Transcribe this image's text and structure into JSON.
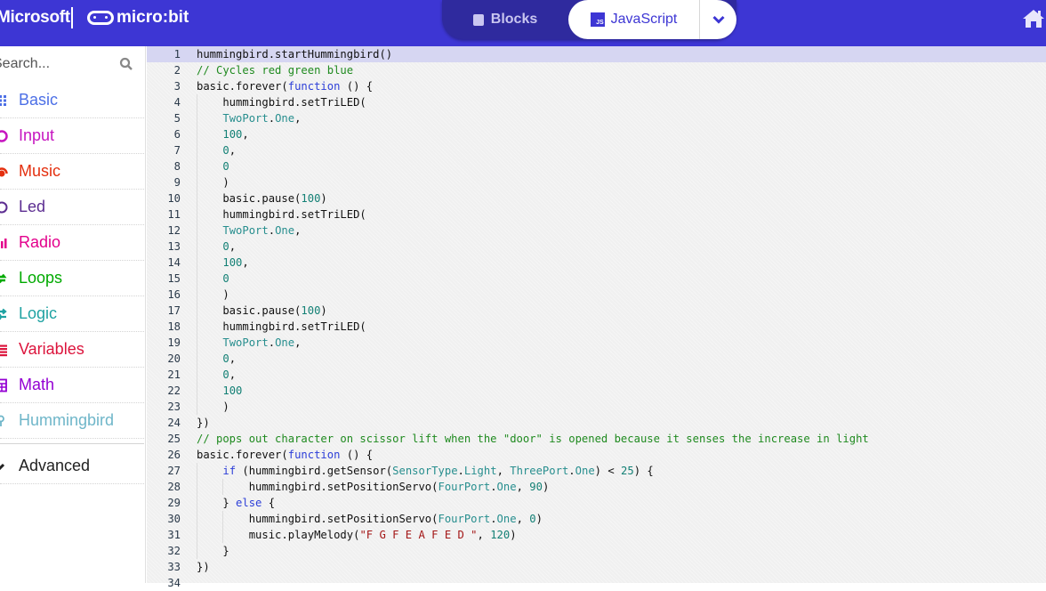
{
  "header": {
    "brand_microsoft": "Microsoft",
    "brand_microbit": "micro:bit",
    "tab_blocks": "Blocks",
    "tab_javascript": "JavaScript",
    "js_badge": "JS",
    "active_tab": "JavaScript",
    "icons": {
      "blocks": "puzzle-icon",
      "more": "chevron-down-icon",
      "home": "home-icon"
    }
  },
  "sidebar": {
    "search_placeholder": "Search...",
    "categories": [
      {
        "label": "Basic",
        "color": "#4c6fe6",
        "icon": "grid-icon"
      },
      {
        "label": "Input",
        "color": "#c616c0",
        "icon": "circle-dot-icon"
      },
      {
        "label": "Music",
        "color": "#e4300f",
        "icon": "headphones-icon"
      },
      {
        "label": "Led",
        "color": "#5c2d91",
        "icon": "toggle-icon"
      },
      {
        "label": "Radio",
        "color": "#e3008c",
        "icon": "signal-bars-icon"
      },
      {
        "label": "Loops",
        "color": "#00aa00",
        "icon": "refresh-icon"
      },
      {
        "label": "Logic",
        "color": "#1fa2a2",
        "icon": "shuffle-icon"
      },
      {
        "label": "Variables",
        "color": "#dc143c",
        "icon": "list-icon"
      },
      {
        "label": "Math",
        "color": "#9400d3",
        "icon": "calculator-icon"
      },
      {
        "label": "Hummingbird",
        "color": "#6fb6c9",
        "icon": "bird-icon"
      }
    ],
    "advanced": {
      "label": "Advanced",
      "color": "#222222",
      "icon": "chevron-icon"
    }
  },
  "editor": {
    "active_line": 1,
    "lines": [
      [
        [
          "hummingbird.startHummingbird()",
          ""
        ]
      ],
      [
        [
          "// Cycles red green blue",
          "c"
        ]
      ],
      [
        [
          "basic.forever(",
          ""
        ],
        [
          "function",
          "k"
        ],
        [
          " () {",
          ""
        ]
      ],
      [
        [
          "    hummingbird.setTriLED(",
          ""
        ]
      ],
      [
        [
          "    ",
          ""
        ],
        [
          "TwoPort",
          "t"
        ],
        [
          ".",
          ""
        ],
        [
          "One",
          "t"
        ],
        [
          ",",
          ""
        ]
      ],
      [
        [
          "    ",
          ""
        ],
        [
          "100",
          "n"
        ],
        [
          ",",
          ""
        ]
      ],
      [
        [
          "    ",
          ""
        ],
        [
          "0",
          "n"
        ],
        [
          ",",
          ""
        ]
      ],
      [
        [
          "    ",
          ""
        ],
        [
          "0",
          "n"
        ]
      ],
      [
        [
          "    )",
          ""
        ]
      ],
      [
        [
          "    basic.pause(",
          ""
        ],
        [
          "100",
          "n"
        ],
        [
          ")",
          ""
        ]
      ],
      [
        [
          "    hummingbird.setTriLED(",
          ""
        ]
      ],
      [
        [
          "    ",
          ""
        ],
        [
          "TwoPort",
          "t"
        ],
        [
          ".",
          ""
        ],
        [
          "One",
          "t"
        ],
        [
          ",",
          ""
        ]
      ],
      [
        [
          "    ",
          ""
        ],
        [
          "0",
          "n"
        ],
        [
          ",",
          ""
        ]
      ],
      [
        [
          "    ",
          ""
        ],
        [
          "100",
          "n"
        ],
        [
          ",",
          ""
        ]
      ],
      [
        [
          "    ",
          ""
        ],
        [
          "0",
          "n"
        ]
      ],
      [
        [
          "    )",
          ""
        ]
      ],
      [
        [
          "    basic.pause(",
          ""
        ],
        [
          "100",
          "n"
        ],
        [
          ")",
          ""
        ]
      ],
      [
        [
          "    hummingbird.setTriLED(",
          ""
        ]
      ],
      [
        [
          "    ",
          ""
        ],
        [
          "TwoPort",
          "t"
        ],
        [
          ".",
          ""
        ],
        [
          "One",
          "t"
        ],
        [
          ",",
          ""
        ]
      ],
      [
        [
          "    ",
          ""
        ],
        [
          "0",
          "n"
        ],
        [
          ",",
          ""
        ]
      ],
      [
        [
          "    ",
          ""
        ],
        [
          "0",
          "n"
        ],
        [
          ",",
          ""
        ]
      ],
      [
        [
          "    ",
          ""
        ],
        [
          "100",
          "n"
        ]
      ],
      [
        [
          "    )",
          ""
        ]
      ],
      [
        [
          "})",
          ""
        ]
      ],
      [
        [
          "// pops out character on scissor lift when the \"door\" is opened because it senses the increase in light",
          "c"
        ]
      ],
      [
        [
          "basic.forever(",
          ""
        ],
        [
          "function",
          "k"
        ],
        [
          " () {",
          ""
        ]
      ],
      [
        [
          "    ",
          ""
        ],
        [
          "if",
          "k"
        ],
        [
          " (hummingbird.getSensor(",
          ""
        ],
        [
          "SensorType",
          "t"
        ],
        [
          ".",
          ""
        ],
        [
          "Light",
          "t"
        ],
        [
          ", ",
          ""
        ],
        [
          "ThreePort",
          "t"
        ],
        [
          ".",
          ""
        ],
        [
          "One",
          "t"
        ],
        [
          ") < ",
          ""
        ],
        [
          "25",
          "n"
        ],
        [
          ") {",
          ""
        ]
      ],
      [
        [
          "        hummingbird.setPositionServo(",
          ""
        ],
        [
          "FourPort",
          "t"
        ],
        [
          ".",
          ""
        ],
        [
          "One",
          "t"
        ],
        [
          ", ",
          ""
        ],
        [
          "90",
          "n"
        ],
        [
          ")",
          ""
        ]
      ],
      [
        [
          "    } ",
          ""
        ],
        [
          "else",
          "k"
        ],
        [
          " {",
          ""
        ]
      ],
      [
        [
          "        hummingbird.setPositionServo(",
          ""
        ],
        [
          "FourPort",
          "t"
        ],
        [
          ".",
          ""
        ],
        [
          "One",
          "t"
        ],
        [
          ", ",
          ""
        ],
        [
          "0",
          "n"
        ],
        [
          ")",
          ""
        ]
      ],
      [
        [
          "        music.playMelody(",
          ""
        ],
        [
          "\"F G F E A F E D \"",
          "s"
        ],
        [
          ", ",
          ""
        ],
        [
          "120",
          "n"
        ],
        [
          ")",
          ""
        ]
      ],
      [
        [
          "    }",
          ""
        ]
      ],
      [
        [
          "})",
          ""
        ]
      ],
      [
        [
          "",
          ""
        ]
      ]
    ]
  }
}
